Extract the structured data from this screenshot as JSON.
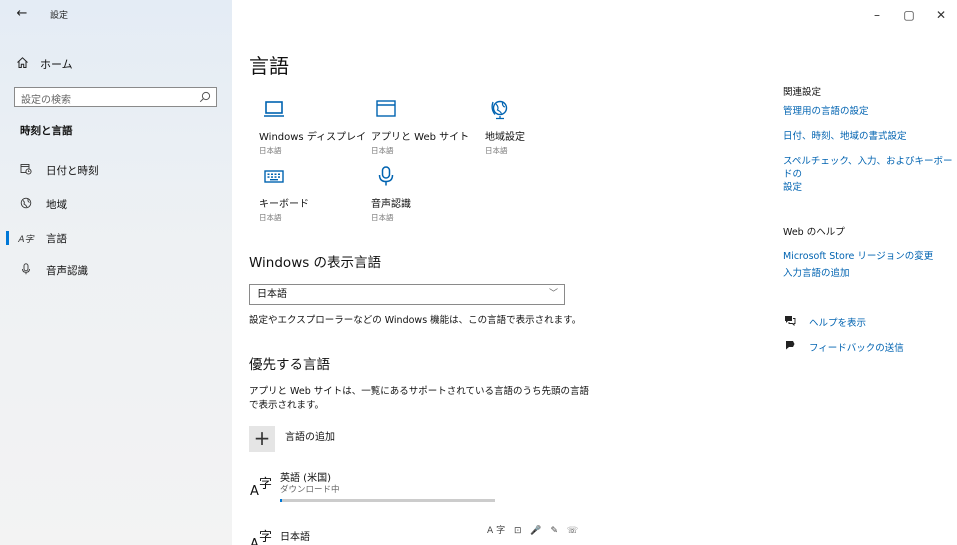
{
  "window": {
    "title": "設定",
    "back": "←",
    "controls": {
      "minimize": "–",
      "maximize": "▢",
      "close": "✕"
    }
  },
  "sidebar": {
    "home": "ホーム",
    "search_placeholder": "設定の検索",
    "section_title": "時刻と言語",
    "items": [
      {
        "label": "日付と時刻",
        "icon": "calendar-clock-icon",
        "active": false
      },
      {
        "label": "地域",
        "icon": "globe-icon",
        "active": false
      },
      {
        "label": "言語",
        "icon": "language-icon",
        "active": true
      },
      {
        "label": "音声認識",
        "icon": "microphone-icon",
        "active": false
      }
    ]
  },
  "main": {
    "title": "言語",
    "tiles": [
      {
        "name": "Windows ディスプレイ",
        "sub": "日本語",
        "icon": "display-icon"
      },
      {
        "name": "アプリと Web サイト",
        "sub": "日本語",
        "icon": "window-icon"
      },
      {
        "name": "地域設定",
        "sub": "日本語",
        "icon": "region-globe-icon"
      },
      {
        "name": "キーボード",
        "sub": "日本語",
        "icon": "keyboard-icon"
      },
      {
        "name": "音声認識",
        "sub": "日本語",
        "icon": "microphone-icon"
      }
    ],
    "display_language": {
      "heading": "Windows の表示言語",
      "selected": "日本語",
      "description": "設定やエクスプローラーなどの Windows 機能は、この言語で表示されます。"
    },
    "preferred": {
      "heading": "優先する言語",
      "description_line1": "アプリと Web サイトは、一覧にあるサポートされている言語のうち先頭の言語",
      "description_line2": "で表示されます。",
      "add_label": "言語の追加",
      "languages": [
        {
          "name": "英語 (米国)",
          "status": "ダウンロード中",
          "progress": 0.01
        },
        {
          "name": "日本語",
          "status": "",
          "feature_icons": "A字 ⊡ 🎤 ✎ ☏"
        }
      ]
    }
  },
  "related": {
    "heading": "関連設定",
    "links": [
      "管理用の言語の設定",
      "日付、時刻、地域の書式設定"
    ],
    "link3_line1": "スペルチェック、入力、およびキーボードの",
    "link3_line2": "設定",
    "web_help_heading": "Web のヘルプ",
    "web_links": [
      "Microsoft Store リージョンの変更",
      "入力言語の追加"
    ],
    "help": "ヘルプを表示",
    "feedback": "フィードバックの送信"
  }
}
